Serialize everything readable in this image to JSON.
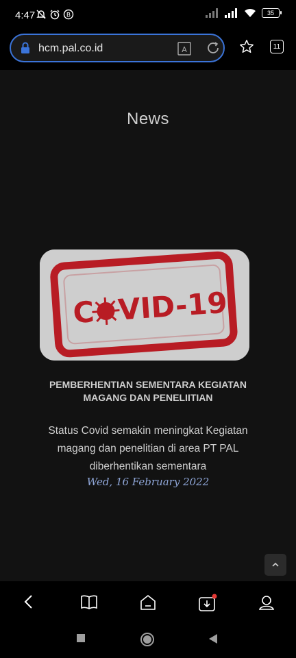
{
  "status_bar": {
    "time": "4:47",
    "battery": "35"
  },
  "browser": {
    "url": "hcm.pal.co.id",
    "tab_count": "11"
  },
  "page": {
    "title": "News",
    "article": {
      "image_stamp_text": "COVID-19",
      "headline": "PEMBERHENTIAN SEMENTARA KEGIATAN MAGANG DAN PENELIITIAN",
      "description": "Status Covid semakin meningkat Kegiatan magang dan penelitian di area PT PAL diberhentikan sementara",
      "date": "Wed, 16 February 2022"
    }
  },
  "colors": {
    "url_border": "#3b74d9",
    "date_text": "#8fa6d8",
    "stamp_red": "#b81c24"
  },
  "icons": {
    "status": [
      "mute-icon",
      "alarm-icon",
      "b-badge-icon",
      "signal-icon",
      "wifi-icon",
      "battery-icon"
    ],
    "browser": [
      "lock-icon",
      "reader-icon",
      "reload-icon",
      "star-icon",
      "tabs-icon"
    ],
    "bottom_nav": [
      "back-icon",
      "bookmarks-icon",
      "home-icon",
      "downloads-icon",
      "profile-icon"
    ]
  }
}
